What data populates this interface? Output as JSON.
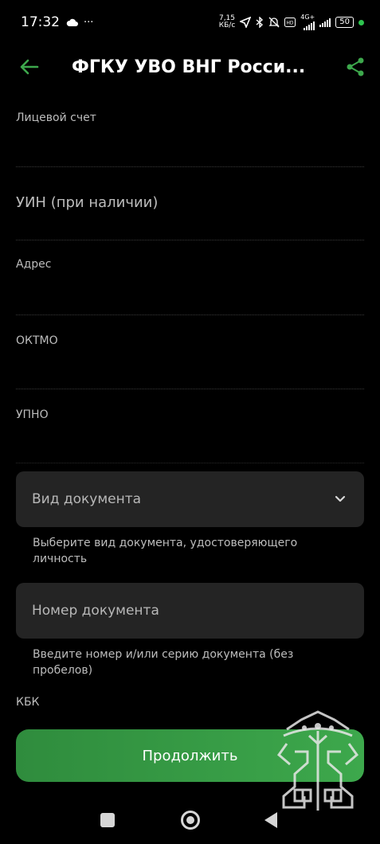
{
  "status_bar": {
    "time": "17:32",
    "left_icons": [
      "cloud-icon",
      "more-dots-icon"
    ],
    "more_dots": "···",
    "network_speed_value": "7,15",
    "network_speed_unit": "КБ/с",
    "network_type": "4G+",
    "battery": "50"
  },
  "header": {
    "title": "ФГКУ УВО ВНГ Росси..."
  },
  "form": {
    "fields": [
      {
        "label": "Лицевой счет",
        "value": ""
      },
      {
        "label": "",
        "value": "УИН (при наличии)"
      },
      {
        "label": "Адрес",
        "value": ""
      },
      {
        "label": "ОКТМО",
        "value": ""
      },
      {
        "label": "УПНО",
        "value": ""
      }
    ],
    "document_type": {
      "placeholder": "Вид документа",
      "helper": "Выберите вид документа, удостоверяющего личность"
    },
    "document_number": {
      "placeholder": "Номер документа",
      "helper": "Введите номер и/или серию документа (без пробелов)"
    },
    "kbk_label": "КБК"
  },
  "actions": {
    "continue_label": "Продолжить"
  },
  "colors": {
    "accent": "#3da84c",
    "background": "#000000",
    "field_bg": "#242424"
  }
}
